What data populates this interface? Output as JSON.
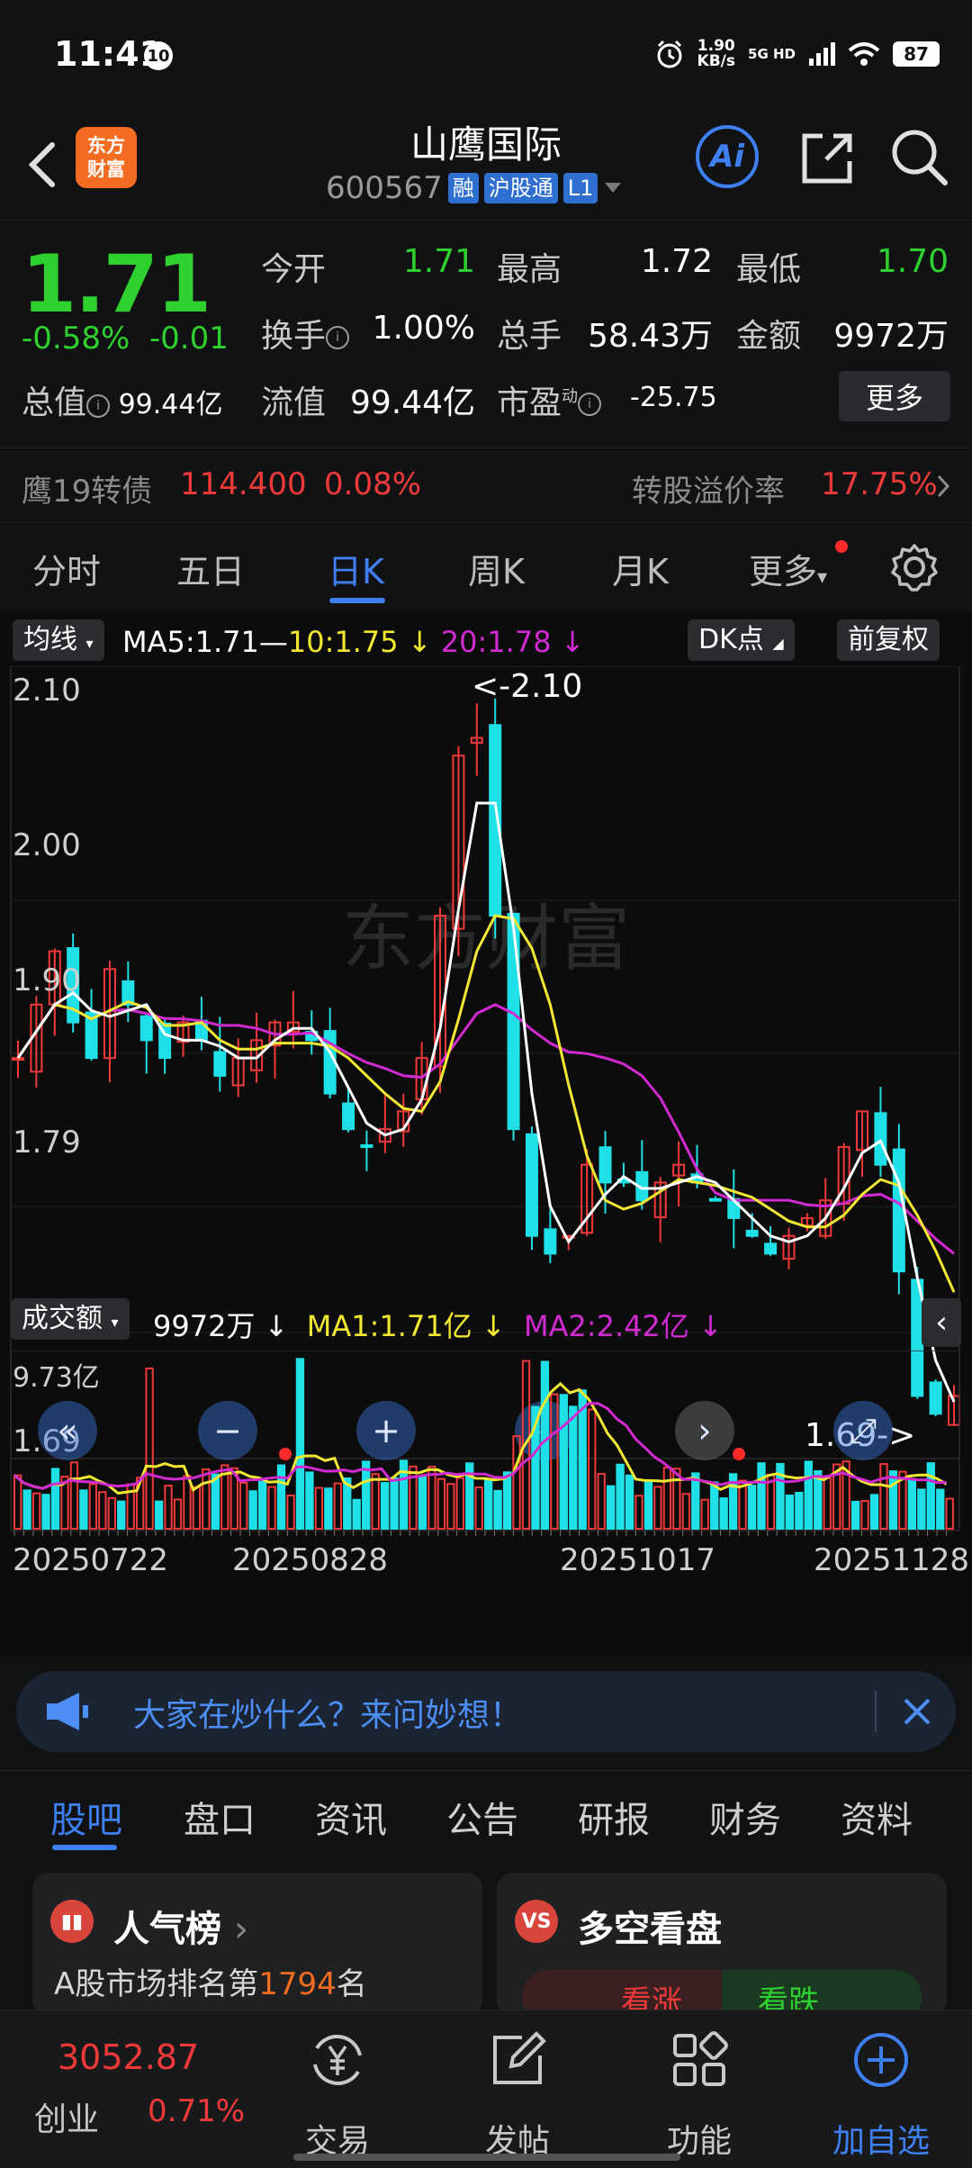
{
  "status_bar": {
    "time": "11:41",
    "notif_badge": "10",
    "net_speed_value": "1.90",
    "net_speed_unit": "KB/s",
    "network": "5G HD",
    "battery": "87"
  },
  "header": {
    "logo_line1": "东方",
    "logo_line2": "财富",
    "stock_name": "山鹰国际",
    "stock_code": "600567",
    "tags": [
      "融",
      "沪股通",
      "L1"
    ],
    "ai_label": "Ai"
  },
  "quote": {
    "price": "1.71",
    "change_pct": "-0.58%",
    "change_abs": "-0.01",
    "open_label": "今开",
    "open_value": "1.71",
    "high_label": "最高",
    "high_value": "1.72",
    "low_label": "最低",
    "low_value": "1.70",
    "turnover_label": "换手",
    "turnover_value": "1.00%",
    "volume_label": "总手",
    "volume_value": "58.43万",
    "amount_label": "金额",
    "amount_value": "9972万",
    "mktcap_label": "总值",
    "mktcap_value": "99.44亿",
    "float_label": "流值",
    "float_value": "99.44亿",
    "pe_label": "市盈",
    "pe_sup": "动",
    "pe_value": "-25.75",
    "more_button": "更多"
  },
  "bond": {
    "name": "鹰19转债",
    "price": "114.400",
    "change": "0.08%",
    "premium_label": "转股溢价率",
    "premium_value": "17.75%"
  },
  "tabs": [
    "分时",
    "五日",
    "日K",
    "周K",
    "月K",
    "更多"
  ],
  "active_tab": "日K",
  "kline": {
    "indicator_chip": "均线",
    "ma5": "MA5:1.71",
    "ma10": "10:1.75 ↓",
    "ma20": "20:1.78 ↓",
    "dk_chip": "DK点",
    "adjust_chip": "前复权",
    "y_labels": [
      "2.10",
      "2.00",
      "1.90",
      "1.79",
      "1.69"
    ],
    "high_marker": "<-2.10",
    "low_marker": "1.69->",
    "watermark": "东方财富"
  },
  "volume": {
    "indicator_chip": "成交额",
    "value": "9972万 ↓",
    "ma1": "MA1:1.71亿 ↓",
    "ma2": "MA2:2.42亿 ↓",
    "y_max_label": "9.73亿",
    "dates": [
      "20250722",
      "20250828",
      "20251017",
      "20251128"
    ]
  },
  "colors": {
    "up": "#f03a3a",
    "down": "#1fe0e6",
    "ma5": "#ffffff",
    "ma10": "#f2e832",
    "ma20": "#d02ad0",
    "accent": "#3e7ff2"
  },
  "banner": {
    "text": "大家在炒什么？来问妙想！"
  },
  "sub_tabs": [
    "股吧",
    "盘口",
    "资讯",
    "公告",
    "研报",
    "财务",
    "资料"
  ],
  "active_sub_tab": "股吧",
  "cards": {
    "popularity": {
      "title": "人气榜",
      "rank_prefix": "A股市场排名第",
      "rank": "1794",
      "rank_suffix": "名"
    },
    "bullbear": {
      "title": "多空看盘",
      "bull": "看涨",
      "bear": "看跌",
      "icon_text": "VS"
    }
  },
  "bottom_nav": {
    "index_value": "3052.87",
    "index_name": "创业",
    "index_change": "0.71%",
    "items": [
      "交易",
      "发帖",
      "功能",
      "加自选"
    ]
  }
}
